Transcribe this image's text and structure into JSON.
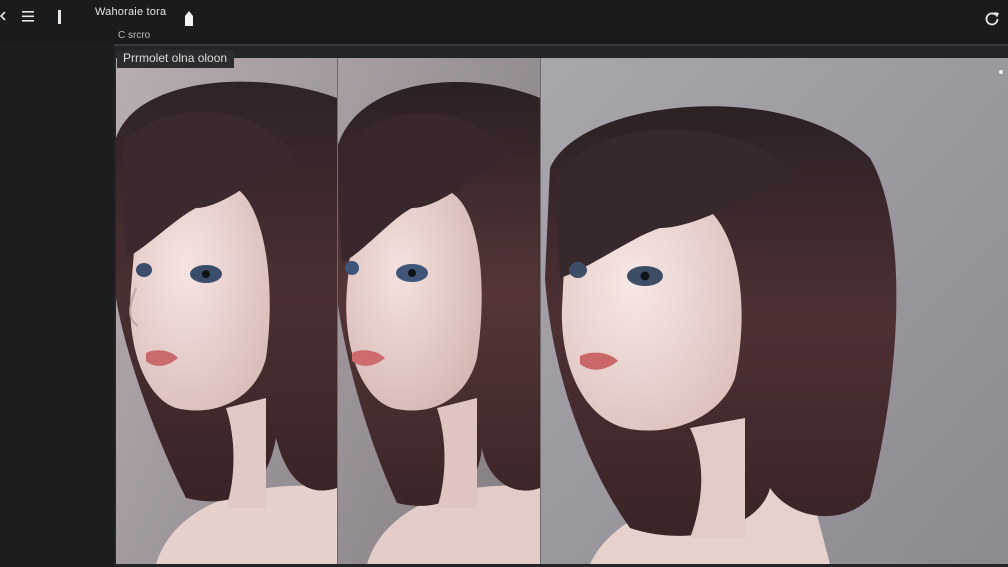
{
  "header": {
    "title": "Wahoraie tora",
    "sub_label": "C srcro"
  },
  "canvas": {
    "prompt_label": "Prrmolet olna oloon"
  },
  "icons": {
    "back": "chevron-left-icon",
    "menu": "menu-icon",
    "divider": "divider-icon",
    "upload": "upload-icon",
    "refresh": "refresh-icon",
    "dot": "dot-icon"
  },
  "colors": {
    "background": "#1a1b1d",
    "canvas": "#232427",
    "text": "#d9d9d9"
  }
}
